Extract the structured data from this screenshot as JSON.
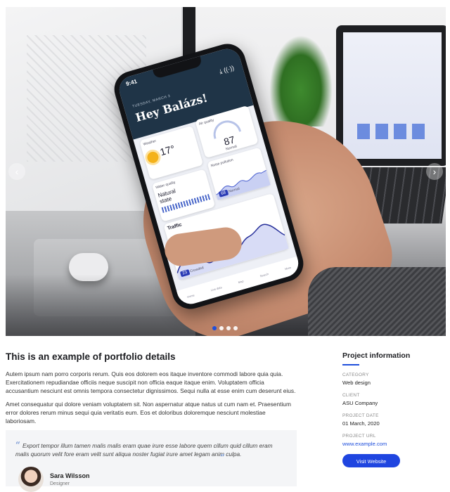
{
  "slider": {
    "phone": {
      "time": "9:41",
      "date": "TUESDAY, MARCH 3",
      "greeting": "Hey Balázs!",
      "weather_label": "Weather",
      "weather_temp": "17°",
      "air_label": "Air quality",
      "air_value": "87",
      "air_status": "Normal",
      "water_label": "Water quality",
      "water_status": "Natural state",
      "noise_label": "Noise pollution",
      "noise_value": "68",
      "noise_status": "Normal",
      "traffic_label": "Traffic",
      "traffic_value": "23",
      "traffic_status": "Crowded",
      "tabs": [
        "Home",
        "Live data",
        "Map",
        "Search",
        "More"
      ]
    },
    "prev_label": "‹",
    "next_label": "›",
    "dots_count": 4,
    "active_dot": 0
  },
  "details": {
    "title": "This is an example of portfolio details",
    "paragraph1": "Autem ipsum nam porro corporis rerum. Quis eos dolorem eos itaque inventore commodi labore quia quia. Exercitationem repudiandae officiis neque suscipit non officia eaque itaque enim. Voluptatem officia accusantium nesciunt est omnis tempora consectetur dignissimos. Sequi nulla at esse enim cum deserunt eius.",
    "paragraph2": "Amet consequatur qui dolore veniam voluptatem sit. Non aspernatur atque natus ut cum nam et. Praesentium error dolores rerum minus sequi quia veritatis eum. Eos et doloribus doloremque nesciunt molestiae laboriosam."
  },
  "testimonial": {
    "quote": "Export tempor illum tamen malis malis eram quae irure esse labore quem cillum quid cillum eram malis quorum velit fore eram velit sunt aliqua noster fugiat irure amet legam anim culpa.",
    "name": "Sara Wilsson",
    "role": "Designer"
  },
  "info": {
    "title": "Project information",
    "category_label": "Category",
    "category_value": "Web design",
    "client_label": "Client",
    "client_value": "ASU Company",
    "date_label": "Project date",
    "date_value": "01 March, 2020",
    "url_label": "Project URL",
    "url_value": "www.example.com",
    "button_label": "Visit Website"
  },
  "colors": {
    "accent": "#1f45e0",
    "link": "#1f4fdc",
    "testimonial_bg": "#f4f5f7"
  }
}
